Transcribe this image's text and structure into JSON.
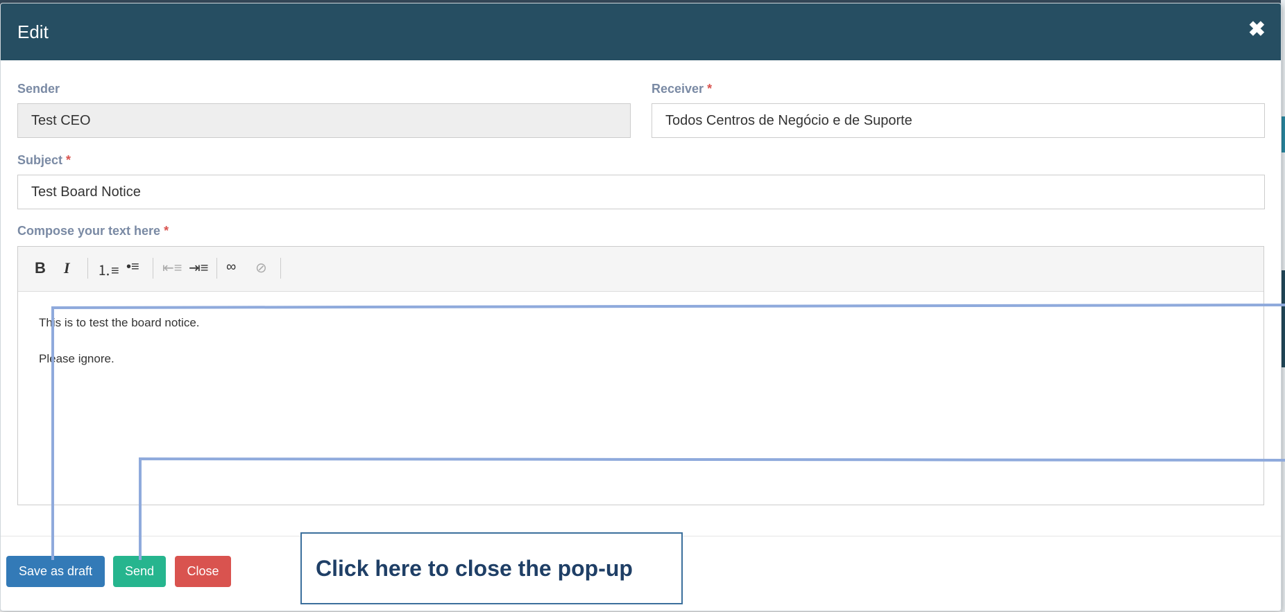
{
  "modal": {
    "title": "Edit",
    "close_icon": "times-icon"
  },
  "form": {
    "sender": {
      "label": "Sender",
      "value": "Test CEO"
    },
    "receiver": {
      "label": "Receiver",
      "required_mark": "*",
      "value": "Todos Centros de Negócio e de Suporte"
    },
    "subject": {
      "label": "Subject",
      "required_mark": "*",
      "value": "Test Board Notice"
    },
    "compose": {
      "label": "Compose your text here",
      "required_mark": "*",
      "toolbar": [
        "bold-icon",
        "italic-icon",
        "ordered-list-icon",
        "unordered-list-icon",
        "outdent-icon",
        "indent-icon",
        "link-icon",
        "unlink-icon"
      ],
      "lines": [
        "This is to test the board notice.",
        "Please ignore."
      ]
    }
  },
  "footer": {
    "save_draft_label": "Save as draft",
    "send_label": "Send",
    "close_label": "Close"
  },
  "annotation": {
    "callout_text": "Click  here to close the pop-up",
    "line_color": "#8faadc"
  },
  "colors": {
    "header": "#264e62",
    "draft": "#337ab7",
    "send": "#26b58e",
    "close": "#d9534f"
  }
}
